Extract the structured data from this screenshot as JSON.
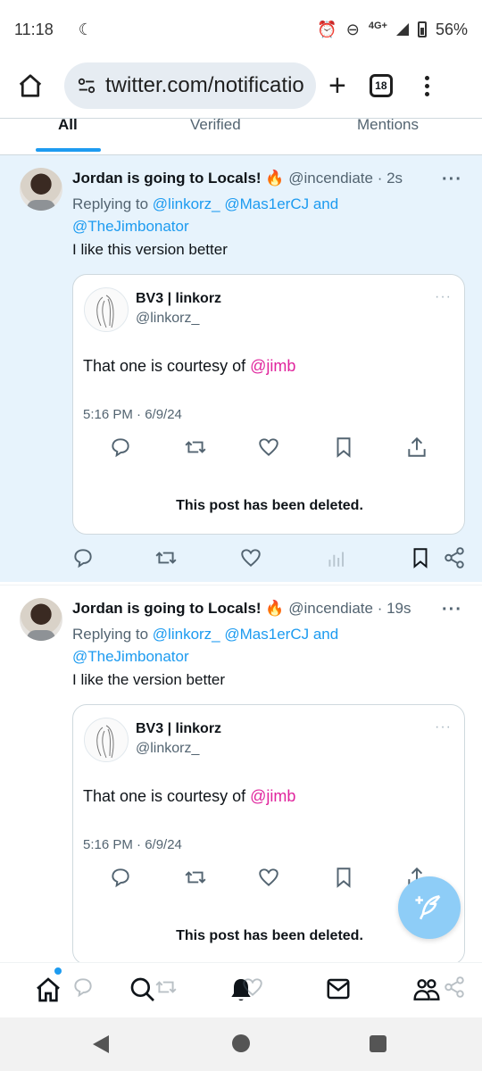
{
  "status_bar": {
    "time": "11:18",
    "network": "4G+",
    "battery": "56%"
  },
  "browser": {
    "url": "twitter.com/notificatio",
    "tab_count": "18"
  },
  "notification_tabs": [
    "All",
    "Verified",
    "Mentions"
  ],
  "tweets": [
    {
      "name": "Jordan is going to Locals! 🔥",
      "handle": "@incendiate",
      "time": "· 2s",
      "replying_prefix": "Replying to",
      "replying_to_1": "@linkorz_",
      "replying_to_2": "@Mas1erCJ",
      "replying_and": "and",
      "replying_to_3": "@TheJimbonator",
      "text": "I like this version better",
      "quote": {
        "name": "BV3 | linkorz",
        "handle": "@linkorz_",
        "text_prefix": "That one is courtesy of",
        "mention": "@jimb",
        "date": "5:16 PM · 6/9/24",
        "deleted_notice": "This post has been deleted."
      }
    },
    {
      "name": "Jordan is going to Locals! 🔥",
      "handle": "@incendiate",
      "time": "· 19s",
      "replying_prefix": "Replying to",
      "replying_to_1": "@linkorz_",
      "replying_to_2": "@Mas1erCJ",
      "replying_and": "and",
      "replying_to_3": "@TheJimbonator",
      "text": "I like the version better",
      "quote": {
        "name": "BV3 | linkorz",
        "handle": "@linkorz_",
        "text_prefix": "That one is courtesy of",
        "mention": "@jimb",
        "date": "5:16 PM · 6/9/24",
        "deleted_notice": "This post has been deleted."
      }
    }
  ],
  "colors": {
    "accent": "#1d9bf0",
    "mention": "#e0249d",
    "highlight_bg": "#e7f3fc",
    "fab": "#8ecdf7"
  }
}
